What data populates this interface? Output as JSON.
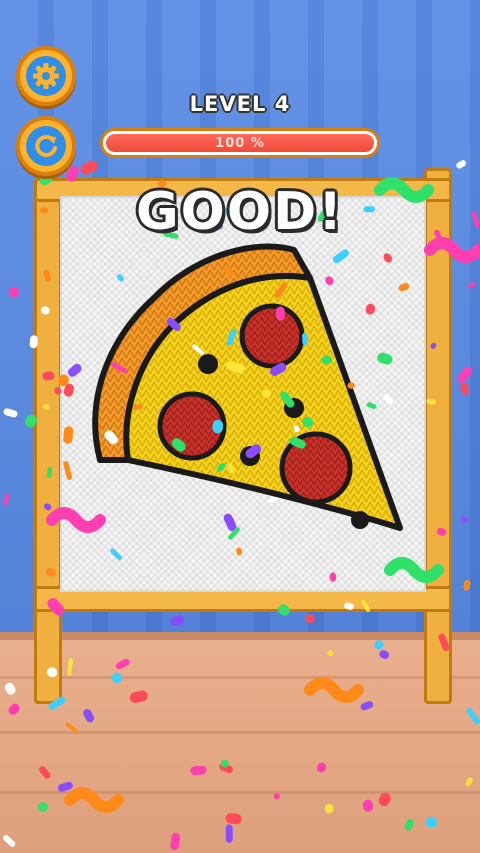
{
  "hud": {
    "settings_icon": "gear-icon",
    "restart_icon": "restart-icon",
    "level_label": "LEVEL 4",
    "progress_text": "100 %",
    "progress_value": 1.0
  },
  "result_text": "GOOD!",
  "artwork": {
    "subject": "pizza-slice",
    "colors": {
      "crust": "#f39a2a",
      "cheese": "#f5d21c",
      "pepperoni": "#c8322a",
      "outline": "#1a1a1a"
    }
  },
  "scene_colors": {
    "wall_stripe_a": "#5b8de6",
    "wall_stripe_b": "#4f82dc",
    "floor": "#e3a884",
    "frame": "#f0b040",
    "button_orange": "#ffb22c",
    "button_blue": "#2f8ee8",
    "progress_fill": "#f04a3a"
  }
}
